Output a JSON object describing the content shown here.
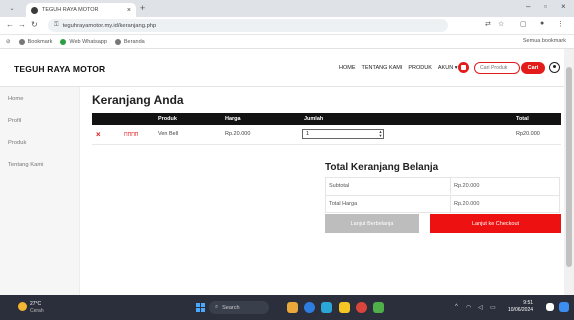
{
  "browser": {
    "tab_title": "TEGUH RAYA MOTOR",
    "tab_close": "×",
    "new_tab": "+",
    "url": "teguhrayamotor.my.id/keranjang.php",
    "bookmarks": [
      "Bookmark",
      "Web Whatsapp",
      "Beranda"
    ],
    "all_bookmarks": "Semua bookmark"
  },
  "site": {
    "brand": "TEGUH RAYA MOTOR",
    "menu": [
      "HOME",
      "TENTANG KAMI",
      "PRODUK",
      "AKUN ▾"
    ],
    "search_placeholder": "Cari Produk",
    "search_button": "Cari"
  },
  "sidebar": {
    "items": [
      "Home",
      "Profil",
      "Produk",
      "Tentang Kami"
    ]
  },
  "cart": {
    "title": "Keranjang Anda",
    "columns": [
      "Produk",
      "Harga",
      "Jumlah",
      "Total"
    ],
    "rows": [
      {
        "remove": "×",
        "thumb": "ПППП",
        "product": "Ven Bell",
        "price": "Rp.20.000",
        "qty": "1",
        "total": "Rp20.000"
      }
    ]
  },
  "totals": {
    "title": "Total Keranjang Belanja",
    "subtotal_label": "Subtotal",
    "subtotal_value": "Rp.20.000",
    "total_label": "Total Harga",
    "total_value": "Rp.20.000"
  },
  "buttons": {
    "continue": "Lanjut Berbelanja",
    "checkout": "Lanjut ke Checkout"
  },
  "taskbar": {
    "weather_temp": "27°C",
    "weather_desc": "Cerah",
    "search": "Search",
    "time": "9:51",
    "date": "10/06/2024"
  },
  "colors": {
    "accent": "#ee1111",
    "header_dark": "#121212",
    "continue_grey": "#bdbdbd"
  }
}
